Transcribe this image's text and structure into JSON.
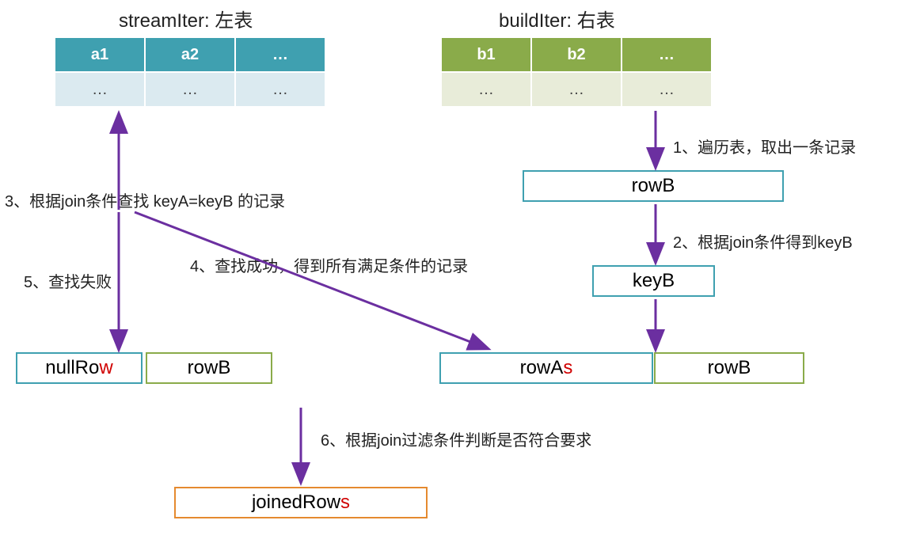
{
  "titles": {
    "left": "streamIter: 左表",
    "right": "buildIter: 右表"
  },
  "leftTable": {
    "headers": [
      "a1",
      "a2",
      "…"
    ],
    "row": [
      "…",
      "…",
      "…"
    ]
  },
  "rightTable": {
    "headers": [
      "b1",
      "b2",
      "…"
    ],
    "row": [
      "…",
      "…",
      "…"
    ]
  },
  "boxes": {
    "rowB": "rowB",
    "keyB": "keyB",
    "nullRow_pre": "nullRo",
    "nullRow_red": "w",
    "rowB2": "rowB",
    "rowA_pre": "rowA",
    "rowA_red": "s",
    "rowB3": "rowB",
    "joined_pre": "joinedRow",
    "joined_red": "s"
  },
  "steps": {
    "s1": "1、遍历表，取出一条记录",
    "s2": "2、根据join条件得到keyB",
    "s3": "3、根据join条件查找 keyA=keyB 的记录",
    "s4": "4、查找成功，得到所有满足条件的记录",
    "s5": "5、查找失败",
    "s6": "6、根据join过滤条件判断是否符合要求"
  }
}
